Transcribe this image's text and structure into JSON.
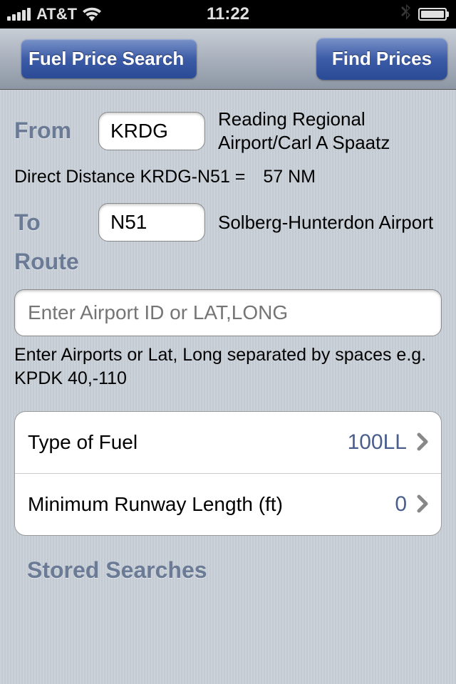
{
  "status_bar": {
    "carrier": "AT&T",
    "time": "11:22"
  },
  "nav": {
    "back_label": "Fuel Price Search",
    "find_label": "Find Prices"
  },
  "form": {
    "from_label": "From",
    "from_value": "KRDG",
    "from_airport": "Reading Regional Airport/Carl A Spaatz",
    "to_label": "To",
    "to_value": "N51",
    "to_airport": "Solberg-Hunterdon Airport",
    "distance_label": "Direct Distance KRDG-N51 =",
    "distance_value": "57 NM"
  },
  "route": {
    "label": "Route",
    "placeholder": "Enter Airport ID or LAT,LONG",
    "helper": "Enter Airports or Lat, Long separated by spaces e.g. KPDK  40,-110"
  },
  "settings": {
    "fuel_label": "Type of Fuel",
    "fuel_value": "100LL",
    "runway_label": "Minimum Runway Length (ft)",
    "runway_value": "0"
  },
  "stored": {
    "label": "Stored Searches"
  }
}
